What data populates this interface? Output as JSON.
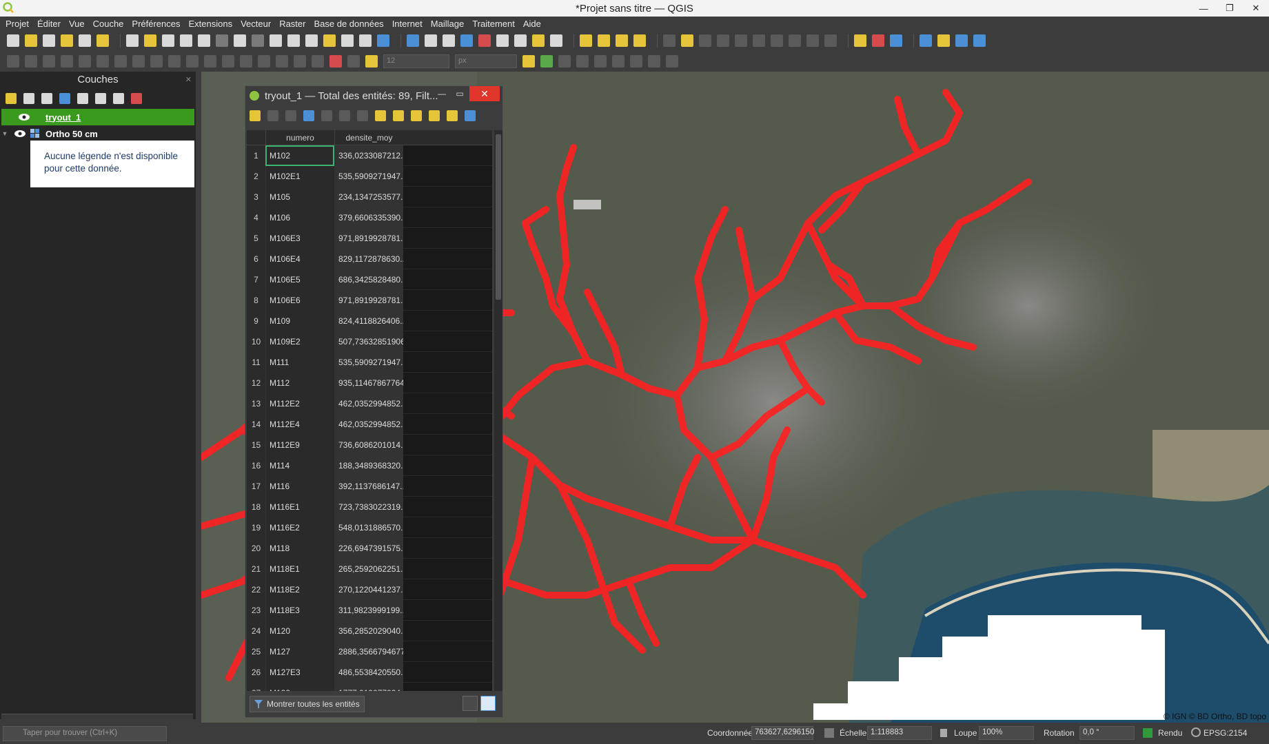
{
  "window": {
    "title": "*Projet sans titre — QGIS",
    "controls": [
      "—",
      "❐",
      "✕"
    ]
  },
  "menu": [
    "Projet",
    "Éditer",
    "Vue",
    "Couche",
    "Préférences",
    "Extensions",
    "Vecteur",
    "Raster",
    "Base de données",
    "Internet",
    "Maillage",
    "Traitement",
    "Aide"
  ],
  "toolbar2": {
    "size_value": "12",
    "unit_value": "px"
  },
  "layers_panel": {
    "title": "Couches",
    "layers": [
      {
        "name": "tryout_1",
        "selected": true
      },
      {
        "name": "Ortho 50 cm",
        "selected": false
      }
    ],
    "legend_note": "Aucune légende n'est disponible pour cette donnée."
  },
  "attribute_table": {
    "title": "tryout_1 — Total des entités: 89, Filt...",
    "columns": [
      "numero",
      "densite_moy"
    ],
    "rows": [
      [
        "1",
        "M102",
        "336,0233087212..."
      ],
      [
        "2",
        "M102E1",
        "535,5909271947..."
      ],
      [
        "3",
        "M105",
        "234,1347253577..."
      ],
      [
        "4",
        "M106",
        "379,6606335390..."
      ],
      [
        "5",
        "M106E3",
        "971,8919928781..."
      ],
      [
        "6",
        "M106E4",
        "829,1172878630..."
      ],
      [
        "7",
        "M106E5",
        "686,3425828480..."
      ],
      [
        "8",
        "M106E6",
        "971,8919928781..."
      ],
      [
        "9",
        "M109",
        "824,4118826406..."
      ],
      [
        "10",
        "M109E2",
        "507,736328519063"
      ],
      [
        "11",
        "M111",
        "535,5909271947..."
      ],
      [
        "12",
        "M112",
        "935,114678677645"
      ],
      [
        "13",
        "M112E2",
        "462,0352994852..."
      ],
      [
        "14",
        "M112E4",
        "462,0352994852..."
      ],
      [
        "15",
        "M112E9",
        "736,6086201014..."
      ],
      [
        "16",
        "M114",
        "188,3489368320..."
      ],
      [
        "17",
        "M116",
        "392,1137686147..."
      ],
      [
        "18",
        "M116E1",
        "723,7383022319..."
      ],
      [
        "19",
        "M116E2",
        "548,0131886570..."
      ],
      [
        "20",
        "M118",
        "226,6947391575..."
      ],
      [
        "21",
        "M118E1",
        "265,2592062251..."
      ],
      [
        "22",
        "M118E2",
        "270,1220441237..."
      ],
      [
        "23",
        "M118E3",
        "311,9823999199..."
      ],
      [
        "24",
        "M120",
        "356,2852029040..."
      ],
      [
        "25",
        "M127",
        "2886,35667946773"
      ],
      [
        "26",
        "M127E3",
        "486,5538420550..."
      ],
      [
        "27",
        "M132",
        "1777,019077924..."
      ]
    ],
    "show_all_button": "Montrer toutes les entités"
  },
  "map": {
    "copyright": "© IGN © BD Ortho, BD topo",
    "route_color": "#ff2020"
  },
  "statusbar": {
    "search_placeholder": "Taper pour trouver (Ctrl+K)",
    "coord_label": "Coordonnée",
    "coord_value": "763627,6296150",
    "scale_label": "Échelle",
    "scale_value": "1:118883",
    "magnifier_label": "Loupe",
    "magnifier_value": "100%",
    "rotation_label": "Rotation",
    "rotation_value": "0,0 °",
    "render_label": "Rendu",
    "crs": "EPSG:2154"
  }
}
